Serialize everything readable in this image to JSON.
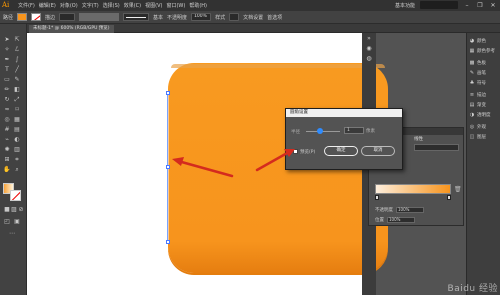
{
  "app": {
    "logo": "Ai"
  },
  "menubar": {
    "items": [
      "文件(F)",
      "编辑(E)",
      "对象(O)",
      "文字(T)",
      "选择(S)",
      "效果(C)",
      "视图(V)",
      "窗口(W)",
      "帮助(H)"
    ],
    "workspace": "基本功能",
    "window_controls": [
      "–",
      "❐",
      "✕"
    ]
  },
  "controlbar": {
    "label_path": "路径",
    "stroke_label": "描边",
    "stroke_value": "",
    "brush_label": "基本",
    "opacity_label": "不透明度",
    "opacity_value": "100%",
    "style_label": "样式",
    "doc_setup": "文档设置",
    "prefs": "首选项"
  },
  "document": {
    "tab_title": "未标题-1* @ 600% (RGB/GPU 预览)"
  },
  "dialog": {
    "title": "圆角设置",
    "radius_label": "半径",
    "radius_value": "1",
    "radius_unit": "像素",
    "preview_label": "预览(P)",
    "ok_label": "确定",
    "cancel_label": "取消"
  },
  "gradient_panel": {
    "type_label": "线性",
    "stroke_label": "描边",
    "opacity_label": "不透明度",
    "opacity_value": "100%",
    "location_label": "位置",
    "location_value": "100%"
  },
  "right_panel": {
    "items": [
      "颜色",
      "颜色参考",
      "色板",
      "画笔",
      "符号",
      "描边",
      "渐变",
      "透明度",
      "外观",
      "图层"
    ]
  },
  "colors": {
    "shape_fill": "#f7941d",
    "arrow": "#d42b1e",
    "selection": "#4a78ff"
  },
  "icons": {
    "toolbar": [
      "selection-tool-icon",
      "direct-selection-tool-icon",
      "magic-wand-icon",
      "lasso-icon",
      "pen-tool-icon",
      "curvature-icon",
      "type-tool-icon",
      "line-tool-icon",
      "rectangle-tool-icon",
      "paintbrush-icon",
      "pencil-icon",
      "eraser-icon",
      "rotate-icon",
      "scale-icon",
      "width-tool-icon",
      "free-transform-icon",
      "shape-builder-icon",
      "perspective-icon",
      "mesh-icon",
      "gradient-tool-icon",
      "eyedropper-icon",
      "blend-icon",
      "symbol-sprayer-icon",
      "graph-icon",
      "artboard-icon",
      "slice-icon",
      "hand-icon",
      "zoom-icon"
    ]
  },
  "watermark": "Baidu 经验"
}
